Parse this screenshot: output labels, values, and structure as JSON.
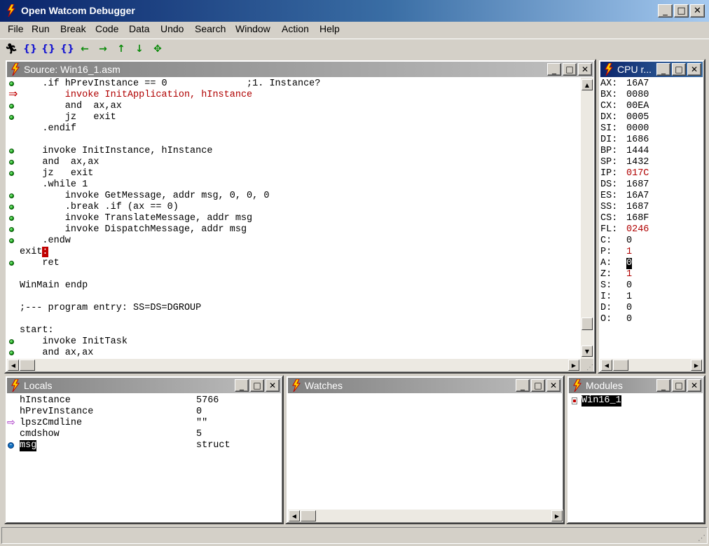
{
  "app": {
    "title": "Open Watcom Debugger"
  },
  "menu": [
    "File",
    "Run",
    "Break",
    "Code",
    "Data",
    "Undo",
    "Search",
    "Window",
    "Action",
    "Help"
  ],
  "toolbar": [
    "run-icon",
    "step-into-icon",
    "step-over-icon",
    "trace-icon",
    "back-icon",
    "forward-icon",
    "up-icon",
    "down-icon",
    "home-icon"
  ],
  "source": {
    "title": "Source: Win16_1.asm",
    "lines": [
      "    .if hPrevInstance == 0              ;1. Instance?",
      "        invoke InitApplication, hInstance",
      "        and  ax,ax",
      "        jz   exit",
      "    .endif",
      "",
      "    invoke InitInstance, hInstance",
      "    and  ax,ax",
      "    jz   exit",
      "    .while 1",
      "        invoke GetMessage, addr msg, 0, 0, 0",
      "        .break .if (ax == 0)",
      "        invoke TranslateMessage, addr msg",
      "        invoke DispatchMessage, addr msg",
      "    .endw",
      "exit:",
      "    ret",
      "",
      "WinMain endp",
      "",
      ";--- program entry: SS=DS=DGROUP",
      "",
      "start:",
      "    invoke InitTask",
      "    and ax,ax"
    ],
    "exit_label": "exit",
    "exit_cursor": ":"
  },
  "cpu": {
    "title": "CPU r...",
    "registers": [
      {
        "name": "AX:",
        "value": "16A7",
        "changed": false
      },
      {
        "name": "BX:",
        "value": "0080",
        "changed": false
      },
      {
        "name": "CX:",
        "value": "00EA",
        "changed": false
      },
      {
        "name": "DX:",
        "value": "0005",
        "changed": false
      },
      {
        "name": "SI:",
        "value": "0000",
        "changed": false
      },
      {
        "name": "DI:",
        "value": "1686",
        "changed": false
      },
      {
        "name": "BP:",
        "value": "1444",
        "changed": false
      },
      {
        "name": "SP:",
        "value": "1432",
        "changed": false
      },
      {
        "name": "IP:",
        "value": "017C",
        "changed": true
      },
      {
        "name": "DS:",
        "value": "1687",
        "changed": false
      },
      {
        "name": "ES:",
        "value": "16A7",
        "changed": false
      },
      {
        "name": "SS:",
        "value": "1687",
        "changed": false
      },
      {
        "name": "CS:",
        "value": "168F",
        "changed": false
      },
      {
        "name": "FL:",
        "value": "0246",
        "changed": true
      },
      {
        "name": "C:",
        "value": "0",
        "changed": false
      },
      {
        "name": "P:",
        "value": "1",
        "changed": true
      },
      {
        "name": "A:",
        "value": "0",
        "changed": false
      },
      {
        "name": "Z:",
        "value": "1",
        "changed": true
      },
      {
        "name": "S:",
        "value": "0",
        "changed": false
      },
      {
        "name": "I:",
        "value": "1",
        "changed": false
      },
      {
        "name": "D:",
        "value": "0",
        "changed": false
      },
      {
        "name": "O:",
        "value": "0",
        "changed": false
      }
    ]
  },
  "locals": {
    "title": "Locals",
    "rows": [
      {
        "name": "hInstance",
        "value": "5766"
      },
      {
        "name": "hPrevInstance",
        "value": "0"
      },
      {
        "name": "lpszCmdline",
        "value": "\"\""
      },
      {
        "name": "cmdshow",
        "value": "5"
      },
      {
        "name": "msg",
        "value": "struct"
      }
    ]
  },
  "watches": {
    "title": "Watches"
  },
  "modules": {
    "title": "Modules",
    "items": [
      "Win16_1"
    ]
  },
  "colors": {
    "changed": "#b00000",
    "title_active": "#0a246a",
    "title_inactive": "#808080"
  }
}
